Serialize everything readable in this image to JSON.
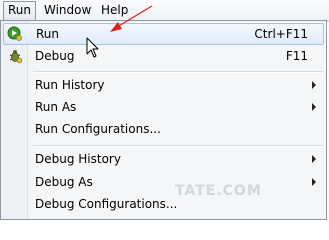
{
  "menubar": {
    "items": [
      "Run",
      "Window",
      "Help"
    ]
  },
  "run_menu": {
    "items": {
      "run": {
        "label": "Run",
        "shortcut": "Ctrl+F11",
        "icon": "run-icon"
      },
      "debug": {
        "label": "Debug",
        "shortcut": "F11",
        "icon": "debug-icon"
      },
      "run_history": {
        "label": "Run History"
      },
      "run_as": {
        "label": "Run As"
      },
      "run_configurations": {
        "label": "Run Configurations..."
      },
      "debug_history": {
        "label": "Debug History"
      },
      "debug_as": {
        "label": "Debug As"
      },
      "debug_configurations": {
        "label": "Debug Configurations..."
      }
    },
    "highlighted": "Run"
  },
  "watermark": "TATE.COM",
  "colors": {
    "highlight_border": "#a8c2e8",
    "annotation_arrow": "#d8231f",
    "run_icon_green": "#3c9a2a"
  }
}
